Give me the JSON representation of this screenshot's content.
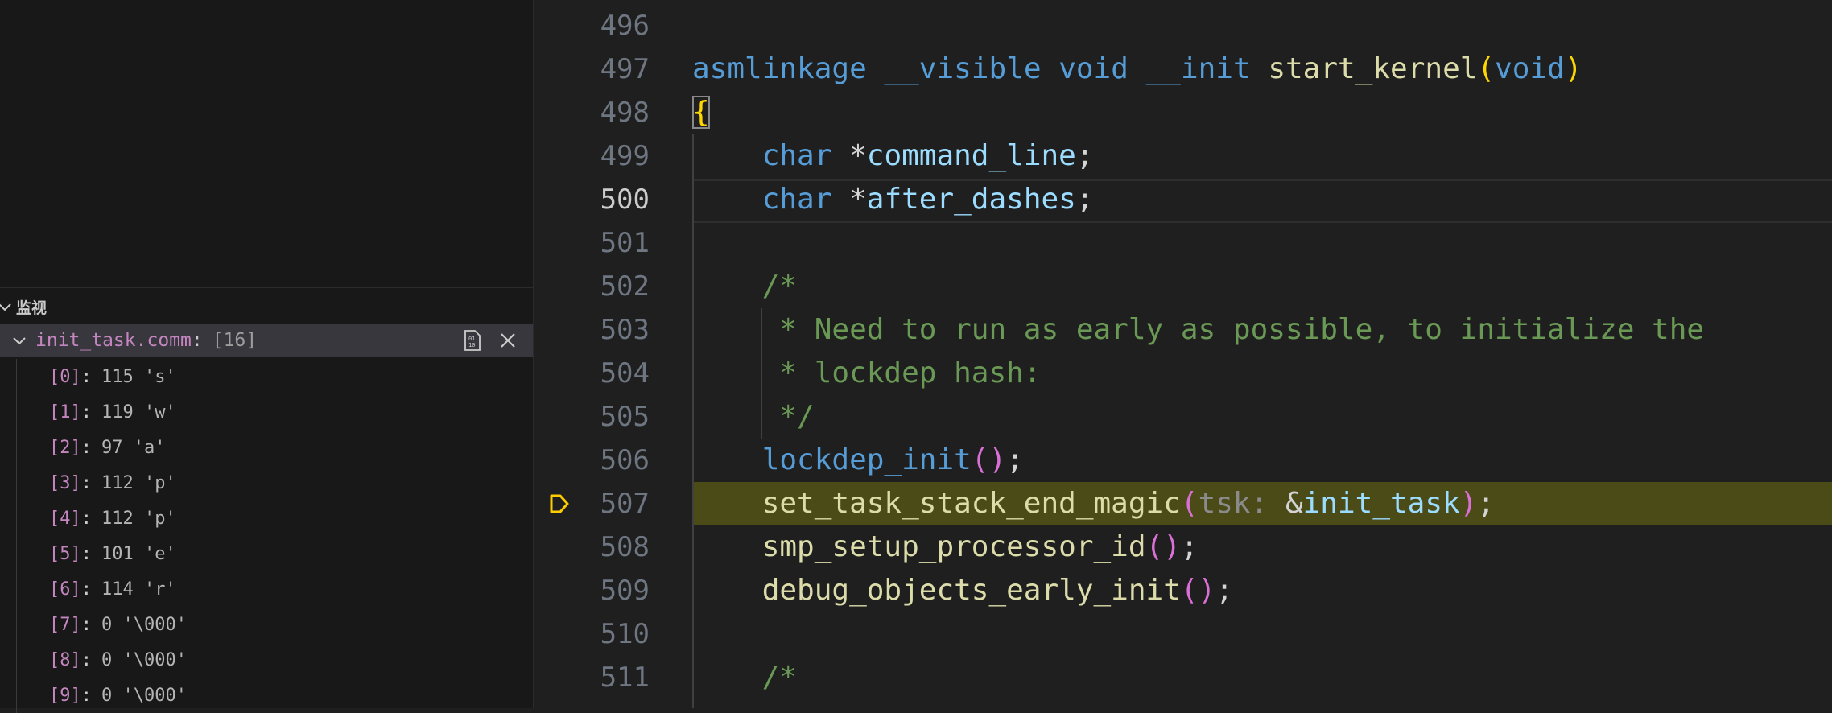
{
  "watch": {
    "header_label": "监视",
    "expression": "init_task.comm",
    "colon": ":",
    "value": "[16]",
    "children": [
      {
        "index": "[0]",
        "value": "115 's'"
      },
      {
        "index": "[1]",
        "value": "119 'w'"
      },
      {
        "index": "[2]",
        "value": "97 'a'"
      },
      {
        "index": "[3]",
        "value": "112 'p'"
      },
      {
        "index": "[4]",
        "value": "112 'p'"
      },
      {
        "index": "[5]",
        "value": "101 'e'"
      },
      {
        "index": "[6]",
        "value": "114 'r'"
      },
      {
        "index": "[7]",
        "value": "0 '\\000'"
      },
      {
        "index": "[8]",
        "value": "0 '\\000'"
      },
      {
        "index": "[9]",
        "value": "0 '\\000'"
      }
    ]
  },
  "editor": {
    "current_line": 500,
    "paused_line": 507,
    "lines": [
      {
        "n": "496",
        "tokens": []
      },
      {
        "n": "497",
        "tokens": [
          [
            "k",
            "asmlinkage"
          ],
          [
            "p",
            " "
          ],
          [
            "k",
            "__visible"
          ],
          [
            "p",
            " "
          ],
          [
            "k",
            "void"
          ],
          [
            "p",
            " "
          ],
          [
            "k",
            "__init"
          ],
          [
            "p",
            " "
          ],
          [
            "f",
            "start_kernel"
          ],
          [
            "y",
            "("
          ],
          [
            "k",
            "void"
          ],
          [
            "y",
            ")"
          ]
        ]
      },
      {
        "n": "498",
        "tokens": [
          [
            "yb",
            "{"
          ]
        ]
      },
      {
        "n": "499",
        "tokens": [
          [
            "p",
            "    "
          ],
          [
            "k",
            "char"
          ],
          [
            "p",
            " *"
          ],
          [
            "v",
            "command_line"
          ],
          [
            "p",
            ";"
          ]
        ]
      },
      {
        "n": "500",
        "tokens": [
          [
            "p",
            "    "
          ],
          [
            "k",
            "char"
          ],
          [
            "p",
            " *"
          ],
          [
            "v",
            "after_dashes"
          ],
          [
            "p",
            ";"
          ]
        ]
      },
      {
        "n": "501",
        "tokens": []
      },
      {
        "n": "502",
        "tokens": [
          [
            "c",
            "    /*"
          ]
        ]
      },
      {
        "n": "503",
        "tokens": [
          [
            "c",
            "     * Need to run as early as possible, to initialize the"
          ]
        ]
      },
      {
        "n": "504",
        "tokens": [
          [
            "c",
            "     * lockdep hash:"
          ]
        ]
      },
      {
        "n": "505",
        "tokens": [
          [
            "c",
            "     */"
          ]
        ]
      },
      {
        "n": "506",
        "tokens": [
          [
            "p",
            "    "
          ],
          [
            "k",
            "lockdep_init"
          ],
          [
            "m",
            "()"
          ],
          [
            "p",
            ";"
          ]
        ]
      },
      {
        "n": "507",
        "tokens": [
          [
            "p",
            "    "
          ],
          [
            "f",
            "set_task_stack_end_magic"
          ],
          [
            "m",
            "("
          ],
          [
            "h",
            "tsk:"
          ],
          [
            "p",
            " &"
          ],
          [
            "v",
            "init_task"
          ],
          [
            "m",
            ")"
          ],
          [
            "p",
            ";"
          ]
        ]
      },
      {
        "n": "508",
        "tokens": [
          [
            "p",
            "    "
          ],
          [
            "f",
            "smp_setup_processor_id"
          ],
          [
            "m",
            "()"
          ],
          [
            "p",
            ";"
          ]
        ]
      },
      {
        "n": "509",
        "tokens": [
          [
            "p",
            "    "
          ],
          [
            "f",
            "debug_objects_early_init"
          ],
          [
            "m",
            "()"
          ],
          [
            "p",
            ";"
          ]
        ]
      },
      {
        "n": "510",
        "tokens": []
      },
      {
        "n": "511",
        "tokens": [
          [
            "c",
            "    /*"
          ]
        ]
      }
    ]
  },
  "colors": {
    "keyword": "#569cd6",
    "function": "#dcdcaa",
    "variable": "#9cdcfe",
    "comment": "#6a9955",
    "bracket1": "#ffd700",
    "bracket2": "#da70d6",
    "debug_line_bg": "#4b4b18",
    "breakpoint_arrow": "#ffcc00"
  },
  "icons": {
    "section_toggle": "chevron-down-icon",
    "watch_expand": "chevron-down-icon",
    "view_binary": "binary-view-icon",
    "remove": "close-icon",
    "paused": "debug-stackframe-arrow-icon"
  }
}
